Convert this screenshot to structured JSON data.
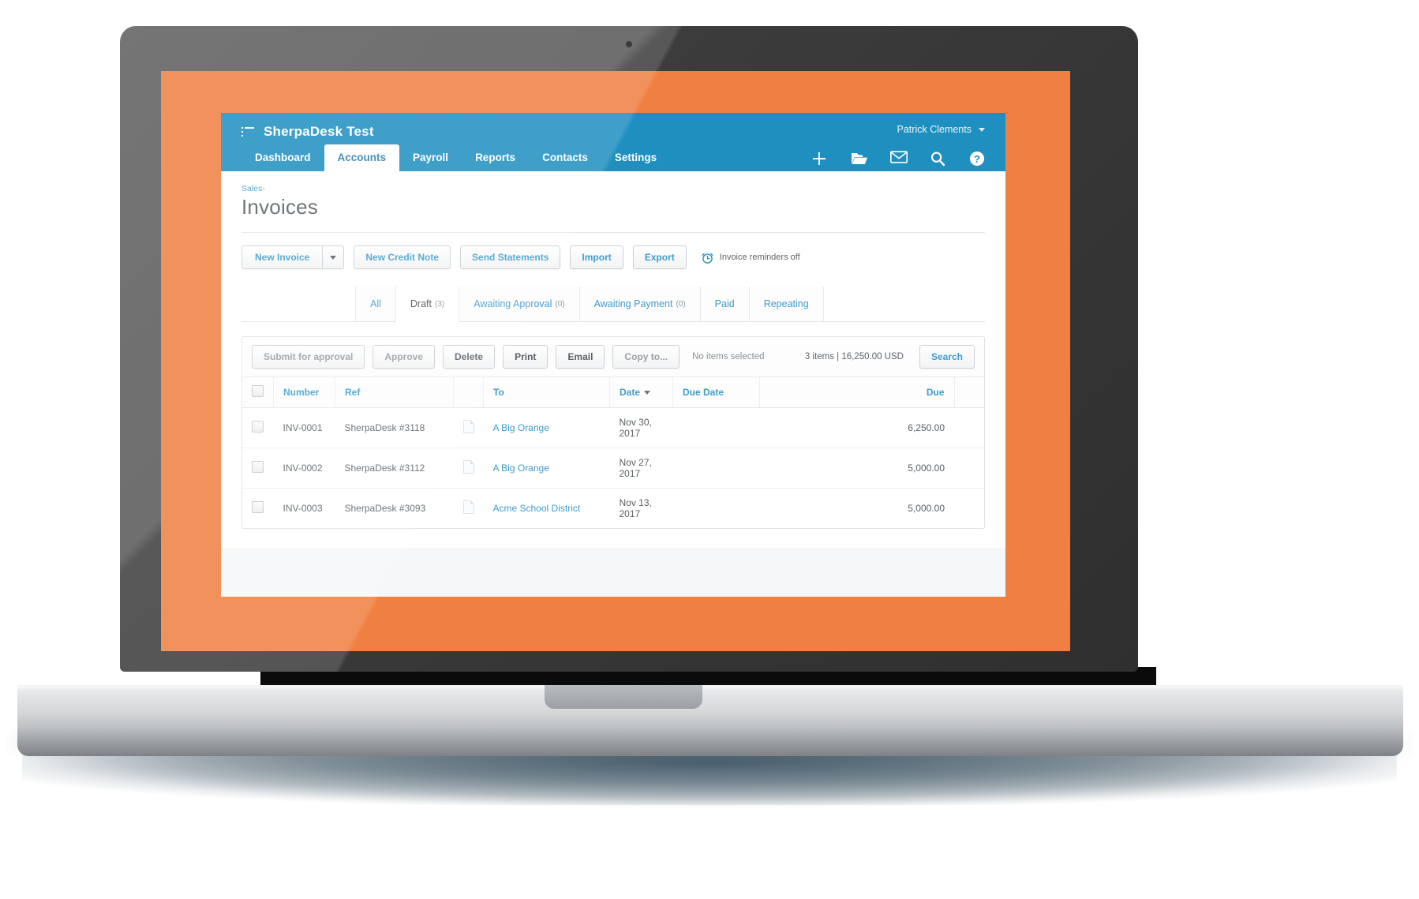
{
  "brand": {
    "title": "SherpaDesk Test",
    "menu_icon": "hamburger-icon"
  },
  "topbar": {
    "user_name": "Patrick Clements",
    "icons": [
      {
        "name": "plus-icon",
        "label": "New"
      },
      {
        "name": "folder-icon",
        "label": "Files"
      },
      {
        "name": "envelope-icon",
        "label": "Messages"
      },
      {
        "name": "search-icon",
        "label": "Search"
      },
      {
        "name": "help-icon",
        "label": "Help"
      }
    ],
    "nav": [
      {
        "label": "Dashboard",
        "active": false
      },
      {
        "label": "Accounts",
        "active": true
      },
      {
        "label": "Payroll",
        "active": false
      },
      {
        "label": "Reports",
        "active": false
      },
      {
        "label": "Contacts",
        "active": false
      },
      {
        "label": "Settings",
        "active": false
      }
    ]
  },
  "breadcrumb": {
    "parent": "Sales",
    "separator": "›"
  },
  "page_title": "Invoices",
  "toolbar": {
    "new_invoice": "New Invoice",
    "new_credit_note": "New Credit Note",
    "send_statements": "Send Statements",
    "import": "Import",
    "export": "Export",
    "reminders": "Invoice reminders off"
  },
  "tabs": [
    {
      "label": "All",
      "count": "",
      "active": false
    },
    {
      "label": "Draft",
      "count": "(3)",
      "active": true
    },
    {
      "label": "Awaiting Approval",
      "count": "(0)",
      "active": false
    },
    {
      "label": "Awaiting Payment",
      "count": "(0)",
      "active": false
    },
    {
      "label": "Paid",
      "count": "",
      "active": false
    },
    {
      "label": "Repeating",
      "count": "",
      "active": false
    }
  ],
  "actionbar": {
    "submit_for_approval": "Submit for approval",
    "approve": "Approve",
    "delete": "Delete",
    "print": "Print",
    "email": "Email",
    "copy_to": "Copy to...",
    "selection_status": "No items selected",
    "summary": "3 items  |  16,250.00  USD",
    "search": "Search"
  },
  "table": {
    "columns": [
      "",
      "Number",
      "Ref",
      "",
      "To",
      "Date",
      "Due Date",
      "Due"
    ],
    "sort_column": "Date",
    "sort_direction": "desc",
    "rows": [
      {
        "number": "INV-0001",
        "ref": "SherpaDesk #3118",
        "to": "A Big Orange",
        "date": "Nov 30, 2017",
        "due_date": "",
        "due": "6,250.00"
      },
      {
        "number": "INV-0002",
        "ref": "SherpaDesk #3112",
        "to": "A Big Orange",
        "date": "Nov 27, 2017",
        "due_date": "",
        "due": "5,000.00"
      },
      {
        "number": "INV-0003",
        "ref": "SherpaDesk #3093",
        "to": "Acme School District",
        "date": "Nov 13, 2017",
        "due_date": "",
        "due": "5,000.00"
      }
    ]
  },
  "colors": {
    "brand_blue": "#1f8fc0",
    "link_blue": "#3f9ccb",
    "backdrop_orange": "#ef8041"
  }
}
